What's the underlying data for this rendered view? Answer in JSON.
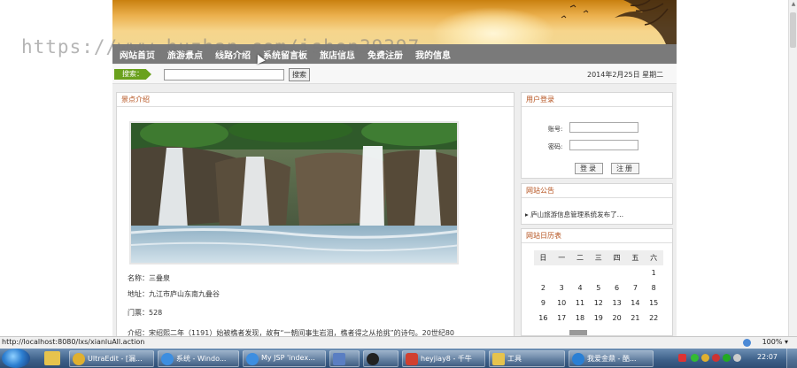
{
  "watermark": "https://www.huzhan.com/ishop39397",
  "nav": {
    "items": [
      "网站首页",
      "旅游景点",
      "线路介绍",
      "系统留言板",
      "旅店信息",
      "免费注册",
      "我的信息"
    ]
  },
  "search": {
    "label": "搜索：",
    "value": "",
    "button": "搜索"
  },
  "date": "2014年2月25日 星期二",
  "scenic": {
    "title": "景点介绍",
    "name": "名称：三叠泉",
    "address": "地址：九江市庐山东南九叠谷",
    "ticket": "门票：528",
    "intro": "介绍：宋绍熙二年（1191）始被樵者发现，故有“一朝间事生岩泪，樵者得之从拾挑”的诗句。20世纪80"
  },
  "login": {
    "title": "用户登录",
    "account_label": "账号:",
    "password_label": "密码:",
    "login_button": "登录",
    "register_button": "注册"
  },
  "notice": {
    "title": "网站公告",
    "item": "庐山旅游信息管理系统发布了…"
  },
  "calendar": {
    "title": "网站日历表",
    "weekdays": [
      "日",
      "一",
      "二",
      "三",
      "四",
      "五",
      "六"
    ],
    "weeks": [
      [
        "",
        "",
        "",
        "",
        "",
        "",
        "1"
      ],
      [
        "2",
        "3",
        "4",
        "5",
        "6",
        "7",
        "8"
      ],
      [
        "9",
        "10",
        "11",
        "12",
        "13",
        "14",
        "15"
      ],
      [
        "16",
        "17",
        "18",
        "19",
        "20",
        "21",
        "22"
      ]
    ]
  },
  "statusbar": {
    "url": "http://localhost:8080/lxs/xianluAll.action",
    "zoom": "100%"
  },
  "taskbar": {
    "tasks": [
      "UltraEdit - [漏...",
      "系统 - Windo...",
      "My JSP 'index...",
      "",
      "heyjiay8 - 千牛",
      "工具",
      "我爱金鼎 - 酷..."
    ],
    "clock": "22:07"
  }
}
